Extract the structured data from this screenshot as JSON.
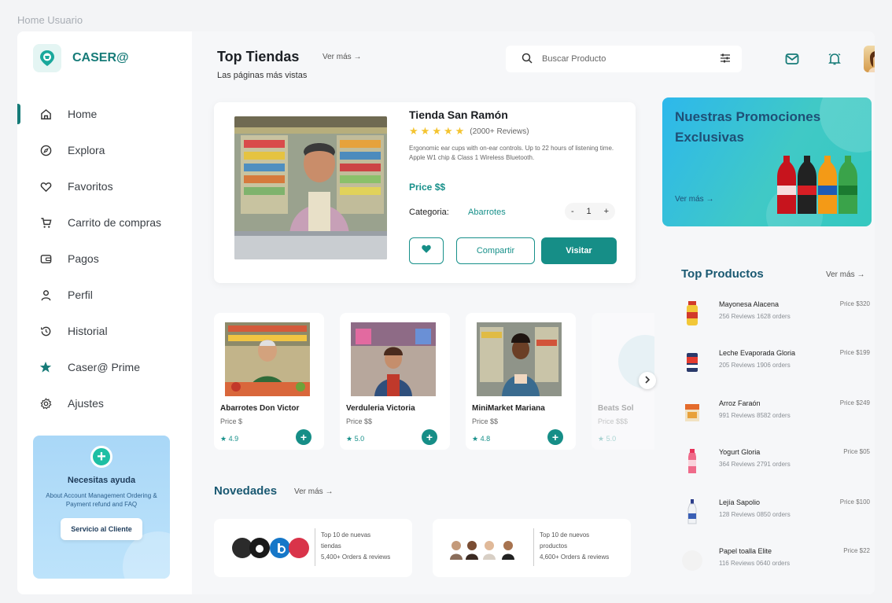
{
  "window_title": "Home Usuario",
  "brand": {
    "name": "CASER@",
    "color": "#167b78"
  },
  "nav": {
    "items": [
      {
        "label": "Home",
        "icon": "home-icon",
        "active": true
      },
      {
        "label": "Explora",
        "icon": "compass-icon"
      },
      {
        "label": "Favoritos",
        "icon": "heart-icon"
      },
      {
        "label": "Carrito de compras",
        "icon": "cart-icon"
      },
      {
        "label": "Pagos",
        "icon": "wallet-icon"
      },
      {
        "label": "Perfil",
        "icon": "user-icon"
      },
      {
        "label": "Historial",
        "icon": "history-icon"
      },
      {
        "label": "Caser@ Prime",
        "icon": "star-icon"
      },
      {
        "label": "Ajustes",
        "icon": "gear-icon"
      }
    ]
  },
  "help": {
    "title": "Necesitas ayuda",
    "description": "About Account Management Ordering & Payment refund and FAQ",
    "button": "Servicio al Cliente"
  },
  "header": {
    "title": "Top Tiendas",
    "ver_mas": "Ver más →",
    "subtitle": "Las páginas más vistas",
    "search_placeholder": "Buscar Producto"
  },
  "featured": {
    "name": "Tienda San Ramón",
    "rating_stars": 5,
    "reviews": "(2000+ Reviews)",
    "description": "Ergonomic ear cups with on-ear controls. Up to 22 hours of listening time. Apple W1 chip & Class 1 Wireless Bluetooth.",
    "price": "Price $$",
    "category_label": "Categoria:",
    "category_value": "Abarrotes",
    "quantity": "1",
    "minus": "-",
    "plus": "+",
    "share_label": "Compartir",
    "visit_label": "Visitar"
  },
  "promo": {
    "title": "Nuestras Promociones Exclusivas",
    "ver_mas": "Ver más →"
  },
  "stores": [
    {
      "name": "Abarrotes Don Victor",
      "price": "Price $",
      "rating": "★ 4.9"
    },
    {
      "name": "Verduleria Victoria",
      "price": "Price $$",
      "rating": "★ 5.0"
    },
    {
      "name": "MiniMarket Mariana",
      "price": "Price $$",
      "rating": "★ 4.8"
    },
    {
      "name": "Beats Sol",
      "price": "Price $$$",
      "rating": "★ 5.0"
    }
  ],
  "novedades": {
    "title": "Novedades",
    "ver_mas": "Ver más →",
    "cards": [
      {
        "line1": "Top 10 de nuevas",
        "line2": "tiendas",
        "line3": "5,400+ Orders & reviews"
      },
      {
        "line1": "Top 10 de nuevos",
        "line2": "productos",
        "line3": "4,600+ Orders & reviews"
      }
    ]
  },
  "top_productos": {
    "title": "Top Productos",
    "ver_mas": "Ver más →",
    "items": [
      {
        "name": "Mayonesa Alacena",
        "meta": "256 Reviews  1628 orders",
        "price": "Price $320"
      },
      {
        "name": "Leche Evaporada Gloria",
        "meta": "205 Reviews  1906 orders",
        "price": "Price $199"
      },
      {
        "name": "Arroz Faraón",
        "meta": "991 Reviews  8582 orders",
        "price": "Price $249"
      },
      {
        "name": "Yogurt Gloria",
        "meta": "364 Reviews  2791 orders",
        "price": "Price $05"
      },
      {
        "name": "Lejía Sapolio",
        "meta": "128 Reviews  0850 orders",
        "price": "Price $100"
      },
      {
        "name": "Papel toalla Elite",
        "meta": "116 Reviews  0640 orders",
        "price": "Price $22"
      }
    ]
  },
  "colors": {
    "accent": "#168e87",
    "star": "#f4c430",
    "promo_bg": "#34c3d8"
  }
}
